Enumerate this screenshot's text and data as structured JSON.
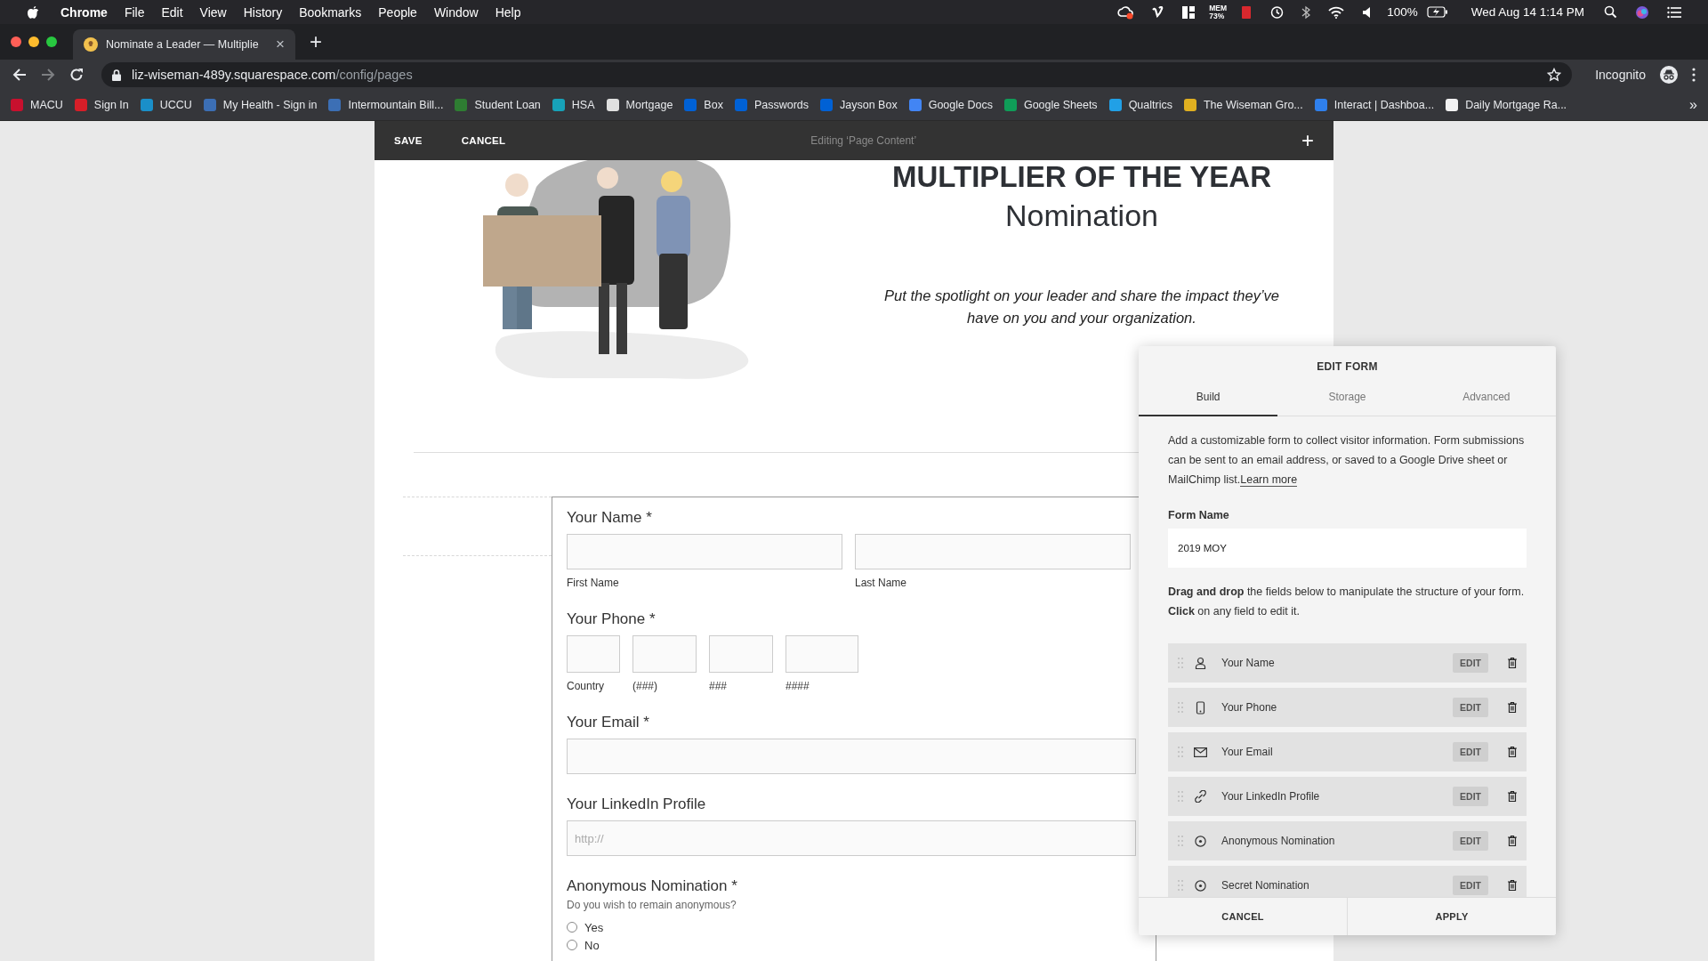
{
  "menu_bar": {
    "app": "Chrome",
    "menus": [
      "File",
      "Edit",
      "View",
      "History",
      "Bookmarks",
      "People",
      "Window",
      "Help"
    ],
    "mem_label": "MEM",
    "mem_value": "73%",
    "battery": "100%",
    "clock": "Wed Aug 14  1:14 PM"
  },
  "browser": {
    "tab": {
      "title": "Nominate a Leader — Multiplie",
      "close": "×",
      "selected": true
    },
    "new_tab": "+",
    "url_host": "liz-wiseman-489y.squarespace.com",
    "url_path": "/config/pages",
    "profile": "Incognito",
    "bookmarks": [
      {
        "label": "MACU",
        "color": "#c8102e"
      },
      {
        "label": "Sign In",
        "color": "#d71e28"
      },
      {
        "label": "UCCU",
        "color": "#1a8fc9"
      },
      {
        "label": "My Health - Sign in",
        "color": "#3c6fb5"
      },
      {
        "label": "Intermountain Bill...",
        "color": "#3c6fb5"
      },
      {
        "label": "Student Loan",
        "color": "#2e7d32"
      },
      {
        "label": "HSA",
        "color": "#17a2b8"
      },
      {
        "label": "Mortgage",
        "color": "#e0e0e0"
      },
      {
        "label": "Box",
        "color": "#0061d5"
      },
      {
        "label": "Passwords",
        "color": "#0061d5"
      },
      {
        "label": "Jayson Box",
        "color": "#0061d5"
      },
      {
        "label": "Google Docs",
        "color": "#4285f4"
      },
      {
        "label": "Google Sheets",
        "color": "#0f9d58"
      },
      {
        "label": "Qualtrics",
        "color": "#21a0e6"
      },
      {
        "label": "The Wiseman Gro...",
        "color": "#e0b020"
      },
      {
        "label": "Interact | Dashboa...",
        "color": "#2f80ed"
      },
      {
        "label": "Daily Mortgage Ra...",
        "color": "#f2f2f2"
      }
    ],
    "more": "»"
  },
  "editor_bar": {
    "save": "SAVE",
    "cancel": "CANCEL",
    "status": "Editing ‘Page Content’",
    "add": "+"
  },
  "hero": {
    "title": "MULTIPLIER OF THE YEAR",
    "subtitle": "Nomination",
    "tagline": "Put the spotlight on your leader and share the impact they’ve have on you and your organization."
  },
  "form": [
    {
      "kind": "name",
      "label": "Your Name *",
      "sublabels": [
        "First Name",
        "Last Name"
      ]
    },
    {
      "kind": "phone",
      "label": "Your Phone *",
      "sublabels": [
        "Country",
        "(###)",
        "###",
        "####"
      ]
    },
    {
      "kind": "text",
      "label": "Your Email *"
    },
    {
      "kind": "text",
      "label": "Your LinkedIn Profile",
      "placeholder": "http://"
    },
    {
      "kind": "radio",
      "label": "Anonymous Nomination *",
      "description": "Do you wish to remain anonymous?",
      "options": [
        {
          "label": "Yes",
          "selected": false
        },
        {
          "label": "No",
          "selected": false
        }
      ]
    }
  ],
  "edit_form": {
    "title": "EDIT FORM",
    "tabs": [
      {
        "label": "Build",
        "selected": true
      },
      {
        "label": "Storage",
        "selected": false
      },
      {
        "label": "Advanced",
        "selected": false
      }
    ],
    "description": "Add a customizable form to collect visitor information. Form submissions can be sent to an email address, or saved to a Google Drive sheet or MailChimp list.",
    "learn_more": "Learn more",
    "form_name_label": "Form Name",
    "form_name_value": "2019 MOY",
    "instructions": "**Drag and drop** the fields below to manipulate the structure of your form. **Click** on any field to edit it.",
    "fields": [
      {
        "kind": "person",
        "label": "Your Name",
        "action": "EDIT"
      },
      {
        "kind": "phone",
        "label": "Your Phone",
        "action": "EDIT"
      },
      {
        "kind": "email",
        "label": "Your Email",
        "action": "EDIT"
      },
      {
        "kind": "link",
        "label": "Your LinkedIn Profile",
        "action": "EDIT"
      },
      {
        "kind": "radio",
        "label": "Anonymous Nomination",
        "action": "EDIT"
      },
      {
        "kind": "radio",
        "label": "Secret Nomination",
        "action": "EDIT"
      }
    ],
    "buttons": [
      "CANCEL",
      "APPLY"
    ]
  }
}
